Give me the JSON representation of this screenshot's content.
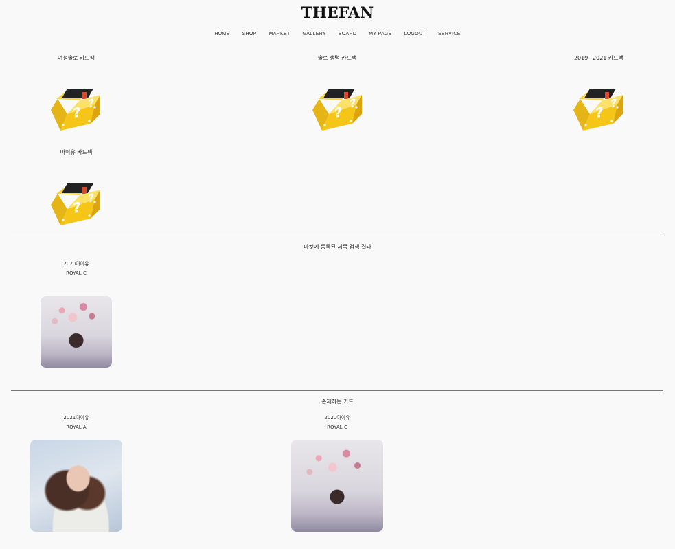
{
  "header": {
    "logo": "THEFAN",
    "nav": [
      "HOME",
      "SHOP",
      "MARKET",
      "GALLERY",
      "BOARD",
      "MY PAGE",
      "LOGOUT",
      "SERVICE"
    ]
  },
  "packs": [
    {
      "title": "여성솔로 카드팩"
    },
    {
      "title": "솔로 생럽 카드팩"
    },
    {
      "title": "2019~2021 카드팩"
    },
    {
      "title": "아이유 카드팩"
    }
  ],
  "market": {
    "title": "마켓에 등록된 제목 검색 결과",
    "items": [
      {
        "name": "2020아이유",
        "grade": "ROYAL-C"
      }
    ]
  },
  "existing": {
    "title": "존재하는 카드",
    "items": [
      {
        "name": "2021아이유",
        "grade": "ROYAL-A"
      },
      {
        "name": "2020아이유",
        "grade": "ROYAL-C"
      }
    ]
  },
  "colors": {
    "box_yellow": "#f5c518",
    "background": "#f9f9f9",
    "divider": "#777777"
  }
}
